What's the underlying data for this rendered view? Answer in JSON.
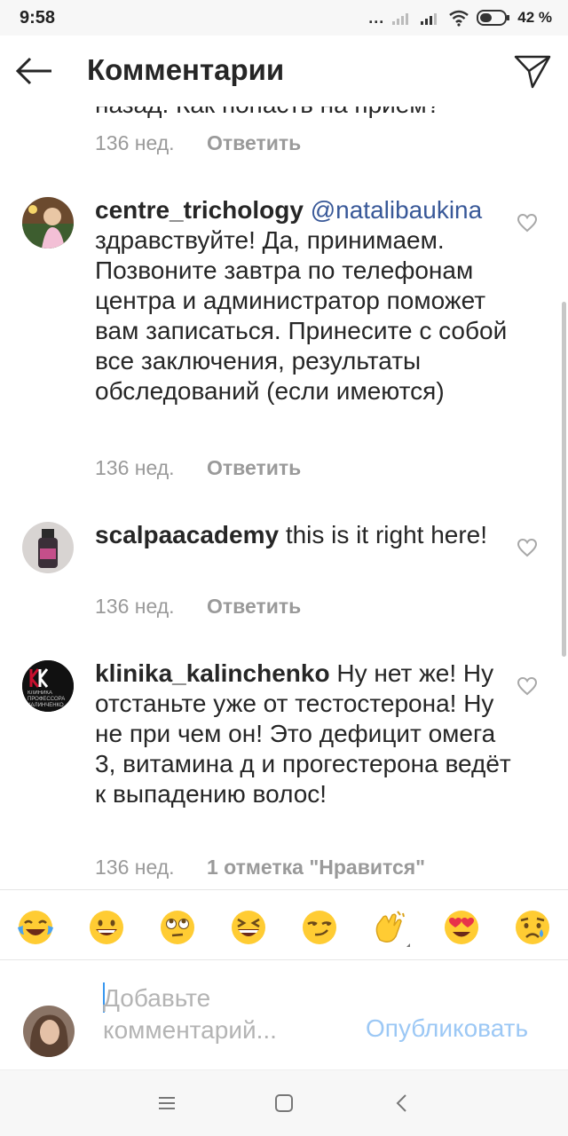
{
  "status_bar": {
    "time": "9:58",
    "battery": "42 %",
    "dots": "..."
  },
  "header": {
    "title": "Комментарии"
  },
  "scroll": {
    "cut_text": "назад. Как попасть на прием?",
    "cut_meta": {
      "time": "136 нед.",
      "reply": "Ответить"
    }
  },
  "comments": [
    {
      "username": "centre_trichology",
      "mention": "@natalibaukina",
      "text": "здравствуйте! Да, принимаем. Позвоните завтра по телефонам центра и администратор поможет вам записаться. Принесите с собой все заключения, результаты обследований (если имеются)",
      "time": "136 нед.",
      "action": "Ответить"
    },
    {
      "username": "scalpaacademy",
      "text": "this is it right here!",
      "time": "136 нед.",
      "action": "Ответить"
    },
    {
      "username": "klinika_kalinchenko",
      "text": "Ну нет же! Ну отстаньте уже от тестостерона! Ну не при чем он! Это дефицит омега 3, витамина д и прогестерона ведёт к выпадению волос!",
      "time": "136 нед.",
      "action": "1 отметка \"Нравится\"",
      "avatar_text": "КЛИНИКА ПРОФЕССОРА КАЛИНЧЕНКО"
    }
  ],
  "emojis": [
    "tears-of-joy",
    "grinning",
    "eye-roll",
    "laughing",
    "smirk",
    "clapping",
    "heart-eyes",
    "crying"
  ],
  "composer": {
    "placeholder": "Добавьте комментарий...",
    "publish": "Опубликовать"
  },
  "colors": {
    "link": "#385898",
    "publish": "#9cc8f5",
    "meta": "#9a9a9a",
    "text": "#262626"
  }
}
